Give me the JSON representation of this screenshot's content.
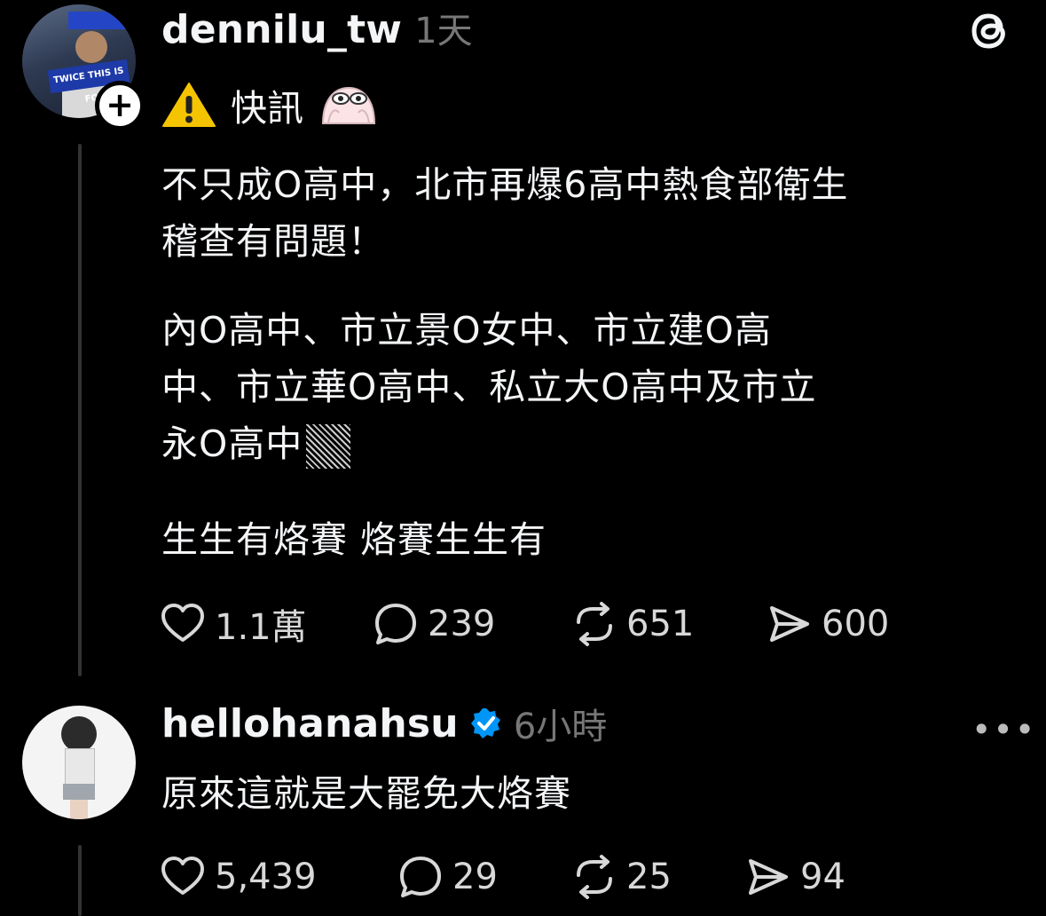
{
  "post": {
    "username": "dennilu_tw",
    "time": "1天",
    "headline_text": "快訊",
    "paragraph1_line1": "不只成O高中，北市再爆6高中熱食部衛生",
    "paragraph1_line2": "稽查有問題！",
    "paragraph2_line1": "內O高中、市立景O女中、市立建O高",
    "paragraph2_line2": "中、市立華O高中、私立大O高中及市立",
    "paragraph2_line3": "永O高中",
    "paragraph3": "生生有烙賽 烙賽生生有",
    "likes": "1.1萬",
    "replies": "239",
    "reposts": "651",
    "shares": "600",
    "avatar_banner_text": "TWICE THIS IS FO"
  },
  "reply": {
    "username": "hellohanahsu",
    "verified": true,
    "time": "6小時",
    "text": "原來這就是大罷免大烙賽",
    "likes": "5,439",
    "replies": "29",
    "reposts": "25",
    "shares": "94"
  },
  "icons": {
    "warning": "warning-icon",
    "emoji": "peeking-face-icon",
    "threads": "threads-logo-icon"
  },
  "colors": {
    "background": "#000000",
    "text": "#f3f5f7",
    "muted": "#777777",
    "verified": "#0095f6",
    "warning": "#f5c400"
  }
}
